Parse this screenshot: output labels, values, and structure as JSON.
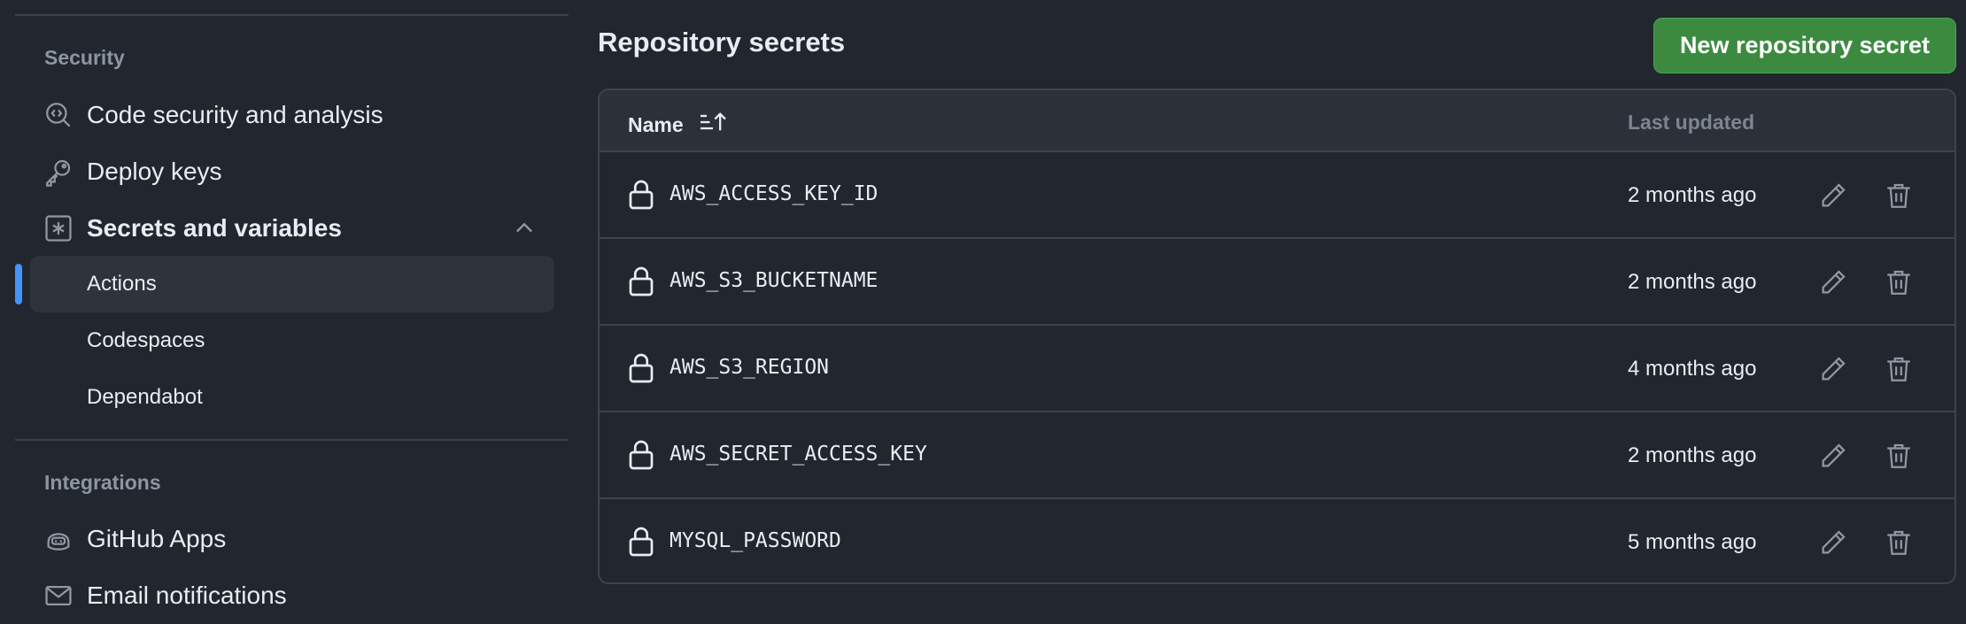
{
  "sidebar": {
    "security_section": "Security",
    "items": [
      {
        "label": "Code security and analysis",
        "icon": "codescan-icon"
      },
      {
        "label": "Deploy keys",
        "icon": "key-icon"
      },
      {
        "label": "Secrets and variables",
        "icon": "asterisk-icon",
        "expanded": true
      }
    ],
    "sub_items": [
      {
        "label": "Actions",
        "active": true
      },
      {
        "label": "Codespaces",
        "active": false
      },
      {
        "label": "Dependabot",
        "active": false
      }
    ],
    "integrations_section": "Integrations",
    "integration_items": [
      {
        "label": "GitHub Apps",
        "icon": "copilot-icon"
      },
      {
        "label": "Email notifications",
        "icon": "mail-icon"
      }
    ]
  },
  "main": {
    "title": "Repository secrets",
    "new_button": "New repository secret",
    "table": {
      "col_name": "Name",
      "col_updated": "Last updated",
      "rows": [
        {
          "name": "AWS_ACCESS_KEY_ID",
          "updated": "2 months ago"
        },
        {
          "name": "AWS_S3_BUCKETNAME",
          "updated": "2 months ago"
        },
        {
          "name": "AWS_S3_REGION",
          "updated": "4 months ago"
        },
        {
          "name": "AWS_SECRET_ACCESS_KEY",
          "updated": "2 months ago"
        },
        {
          "name": "MYSQL_PASSWORD",
          "updated": "5 months ago"
        }
      ]
    }
  },
  "colors": {
    "background": "#22262e",
    "accent_blue": "#4493f8",
    "button_green": "#3c8a40"
  }
}
